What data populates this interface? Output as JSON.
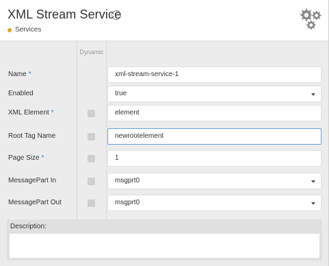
{
  "header": {
    "title": "XML Stream Service",
    "help_icon": "?",
    "breadcrumb": "Services",
    "breadcrumb_dot_color": "#e8a030",
    "settings_icon": "gears-icon"
  },
  "form": {
    "dynamic_header": "Dynamic",
    "rows": [
      {
        "label": "Name",
        "required": true,
        "dynamic": false,
        "value": "xml-stream-service-1",
        "type": "text"
      },
      {
        "label": "Enabled",
        "required": false,
        "dynamic": false,
        "value": "true",
        "type": "select"
      },
      {
        "label": "XML Element",
        "required": true,
        "dynamic": true,
        "value": "element",
        "type": "text"
      },
      {
        "label": "Root Tag Name",
        "required": false,
        "dynamic": true,
        "value": "newrootelement",
        "type": "text",
        "focused": true
      },
      {
        "label": "Page Size",
        "required": true,
        "dynamic": true,
        "value": "1",
        "type": "text"
      },
      {
        "label": "MessagePart In",
        "required": false,
        "dynamic": true,
        "value": "msgprt0",
        "type": "select"
      },
      {
        "label": "MessagePart Out",
        "required": false,
        "dynamic": true,
        "value": "msgprt0",
        "type": "select"
      }
    ],
    "required_marker": "*"
  },
  "description": {
    "label": "Description:",
    "value": ""
  }
}
